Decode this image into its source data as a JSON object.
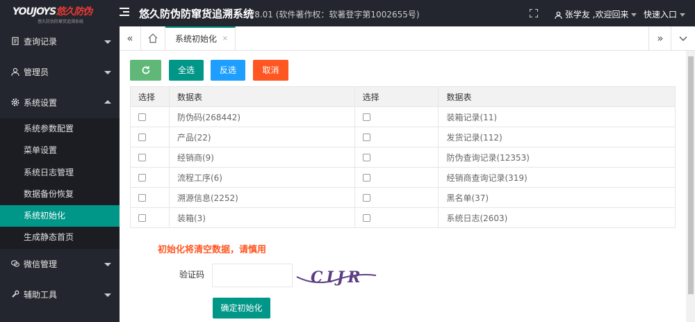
{
  "header": {
    "logo_brand": "YOUJOYS",
    "logo_cn": "悠久防伪",
    "logo_sub": "悠久防伪防窜货追溯系统",
    "title": "悠久防伪防窜货追溯系统",
    "version": "V8.01 (软件著作权：软著登字第1002655号)",
    "user_greeting": "张学友 ,欢迎回来",
    "quick_entry": "快速入口"
  },
  "sidebar": {
    "items": [
      {
        "label": "查询记录",
        "icon": "document-icon",
        "expanded": false
      },
      {
        "label": "管理员",
        "icon": "user-icon",
        "expanded": false
      },
      {
        "label": "系统设置",
        "icon": "gear-icon",
        "expanded": true
      },
      {
        "label": "微信管理",
        "icon": "chat-icon",
        "expanded": false
      },
      {
        "label": "辅助工具",
        "icon": "wrench-icon",
        "expanded": false
      }
    ],
    "sub_items": [
      {
        "label": "系统参数配置",
        "active": false
      },
      {
        "label": "菜单设置",
        "active": false
      },
      {
        "label": "系统日志管理",
        "active": false
      },
      {
        "label": "数据备份恢复",
        "active": false
      },
      {
        "label": "系统初始化",
        "active": true
      },
      {
        "label": "生成静态首页",
        "active": false
      }
    ]
  },
  "tabs": {
    "active_label": "系统初始化",
    "close_symbol": "×"
  },
  "toolbar": {
    "refresh_icon": "refresh-icon",
    "select_all": "全选",
    "invert": "反选",
    "cancel": "取消"
  },
  "table": {
    "headers": [
      "选择",
      "数据表",
      "选择",
      "数据表"
    ],
    "rows": [
      [
        "防伪码(268442)",
        "装箱记录(11)"
      ],
      [
        "产品(22)",
        "发货记录(112)"
      ],
      [
        "经销商(9)",
        "防伪查询记录(12353)"
      ],
      [
        "流程工序(6)",
        "经销商查询记录(319)"
      ],
      [
        "溯源信息(2252)",
        "黑名单(37)"
      ],
      [
        "装箱(3)",
        "系统日志(2603)"
      ]
    ]
  },
  "form": {
    "warning": "初始化将清空数据，请慎用",
    "captcha_label": "验证码",
    "captcha_input_value": "",
    "captcha_text": "CIJR",
    "confirm": "确定初始化"
  },
  "colors": {
    "accent": "#009688",
    "refresh": "#5fb878",
    "blue": "#1e9fff",
    "orange": "#ff5722",
    "dark": "#23262e"
  }
}
